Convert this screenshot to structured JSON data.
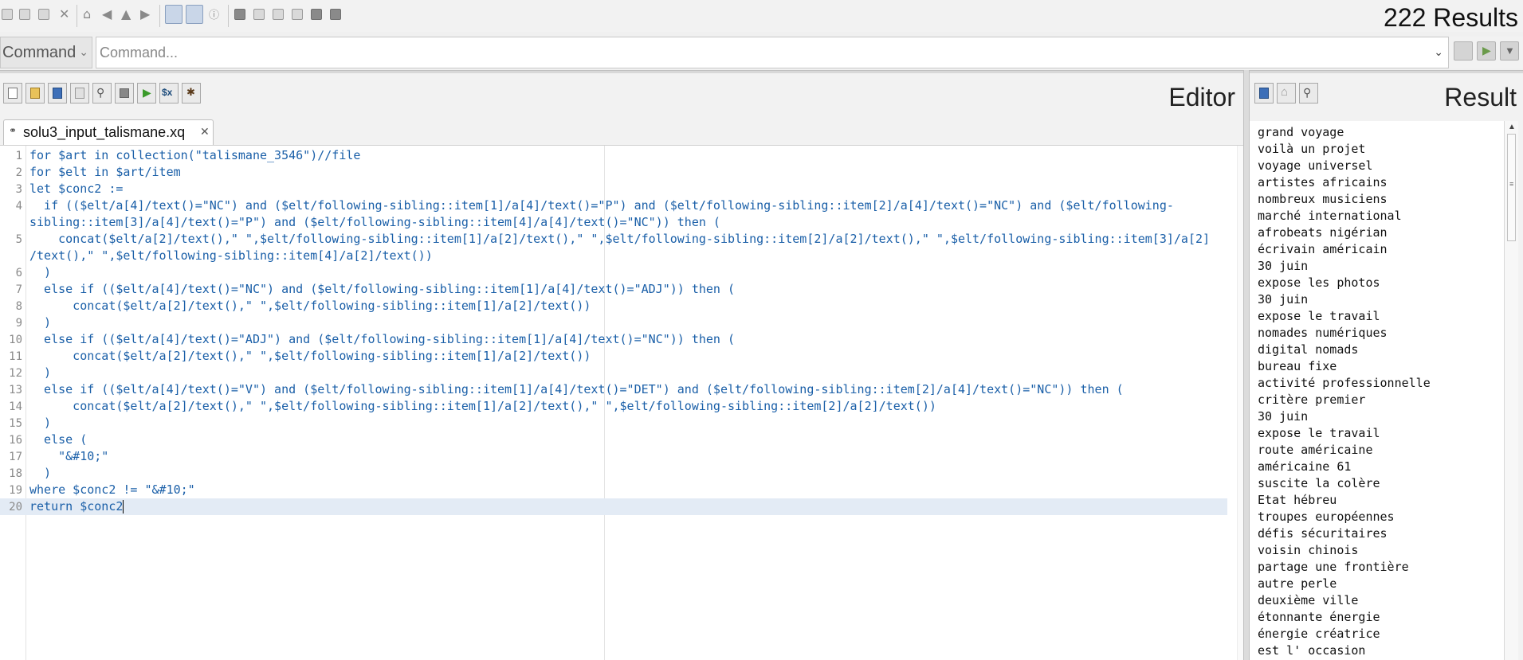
{
  "results_count": "222 Results",
  "command": {
    "mode": "Command",
    "placeholder": "Command..."
  },
  "editor": {
    "title": "Editor",
    "tab_name": "solu3_input_talismane.xq",
    "lines": [
      {
        "n": "1",
        "text": "for $art in collection(\"talismane_3546\")//file"
      },
      {
        "n": "2",
        "text": "for $elt in $art/item"
      },
      {
        "n": "3",
        "text": "let $conc2 :="
      },
      {
        "n": "4",
        "text": "  if (($elt/a[4]/text()=\"NC\") and ($elt/following-sibling::item[1]/a[4]/text()=\"P\") and ($elt/following-sibling::item[2]/a[4]/text()=\"NC\") and ($elt/following-"
      },
      {
        "n": "",
        "text": "sibling::item[3]/a[4]/text()=\"P\") and ($elt/following-sibling::item[4]/a[4]/text()=\"NC\")) then ("
      },
      {
        "n": "5",
        "text": "    concat($elt/a[2]/text(),\" \",$elt/following-sibling::item[1]/a[2]/text(),\" \",$elt/following-sibling::item[2]/a[2]/text(),\" \",$elt/following-sibling::item[3]/a[2]"
      },
      {
        "n": "",
        "text": "/text(),\" \",$elt/following-sibling::item[4]/a[2]/text())"
      },
      {
        "n": "6",
        "text": "  )"
      },
      {
        "n": "7",
        "text": "  else if (($elt/a[4]/text()=\"NC\") and ($elt/following-sibling::item[1]/a[4]/text()=\"ADJ\")) then ("
      },
      {
        "n": "8",
        "text": "      concat($elt/a[2]/text(),\" \",$elt/following-sibling::item[1]/a[2]/text())"
      },
      {
        "n": "9",
        "text": "  )"
      },
      {
        "n": "10",
        "text": "  else if (($elt/a[4]/text()=\"ADJ\") and ($elt/following-sibling::item[1]/a[4]/text()=\"NC\")) then ("
      },
      {
        "n": "11",
        "text": "      concat($elt/a[2]/text(),\" \",$elt/following-sibling::item[1]/a[2]/text())"
      },
      {
        "n": "12",
        "text": "  )"
      },
      {
        "n": "13",
        "text": "  else if (($elt/a[4]/text()=\"V\") and ($elt/following-sibling::item[1]/a[4]/text()=\"DET\") and ($elt/following-sibling::item[2]/a[4]/text()=\"NC\")) then ("
      },
      {
        "n": "14",
        "text": "      concat($elt/a[2]/text(),\" \",$elt/following-sibling::item[1]/a[2]/text(),\" \",$elt/following-sibling::item[2]/a[2]/text())"
      },
      {
        "n": "15",
        "text": "  )"
      },
      {
        "n": "16",
        "text": "  else ("
      },
      {
        "n": "17",
        "text": "    \"&#10;\""
      },
      {
        "n": "18",
        "text": "  )"
      },
      {
        "n": "19",
        "text": "where $conc2 != \"&#10;\""
      },
      {
        "n": "20",
        "text": "return $conc2"
      }
    ]
  },
  "result": {
    "title": "Result",
    "items": [
      "grand voyage",
      "voilà un projet",
      "voyage universel",
      "artistes africains",
      "nombreux musiciens",
      "marché international",
      "afrobeats nigérian",
      "écrivain américain",
      "30 juin",
      "expose les photos",
      "30 juin",
      "expose le travail",
      "nomades numériques",
      "digital nomads",
      "bureau fixe",
      "activité professionnelle",
      "critère premier",
      "30 juin",
      "expose le travail",
      "route américaine",
      "américaine 61",
      "suscite la colère",
      "Etat hébreu",
      "troupes européennes",
      "défis sécuritaires",
      "voisin chinois",
      "partage une frontière",
      "autre perle",
      "deuxième ville",
      "étonnante énergie",
      "énergie créatrice",
      "est l' occasion"
    ]
  }
}
